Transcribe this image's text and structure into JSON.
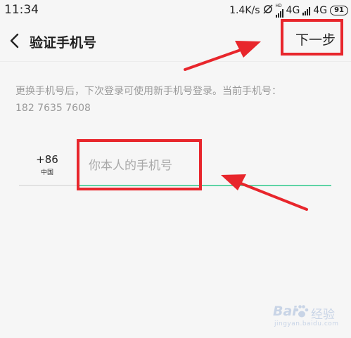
{
  "status_bar": {
    "time": "11:34",
    "net_speed": "1.4K/s",
    "sim1": "4G",
    "sim2": "4G",
    "battery": "91",
    "hd_label": "HD"
  },
  "nav": {
    "back_icon": "chevron-left-icon",
    "title": "验证手机号",
    "next_label": "下一步"
  },
  "description": {
    "line1": "更换手机号后，下次登录可使用新手机号登录。当前手机号：",
    "line2": "182 7635 7608"
  },
  "phone_form": {
    "country_code": "+86",
    "country_name": "中国",
    "placeholder": "你本人的手机号",
    "value": ""
  },
  "annotations": {
    "highlight_color": "#e8262c",
    "accent_color": "#5ed3a5"
  },
  "watermark": {
    "brand_left": "Bai",
    "brand_right": "经验",
    "url": "jingyan.baidu.com"
  }
}
